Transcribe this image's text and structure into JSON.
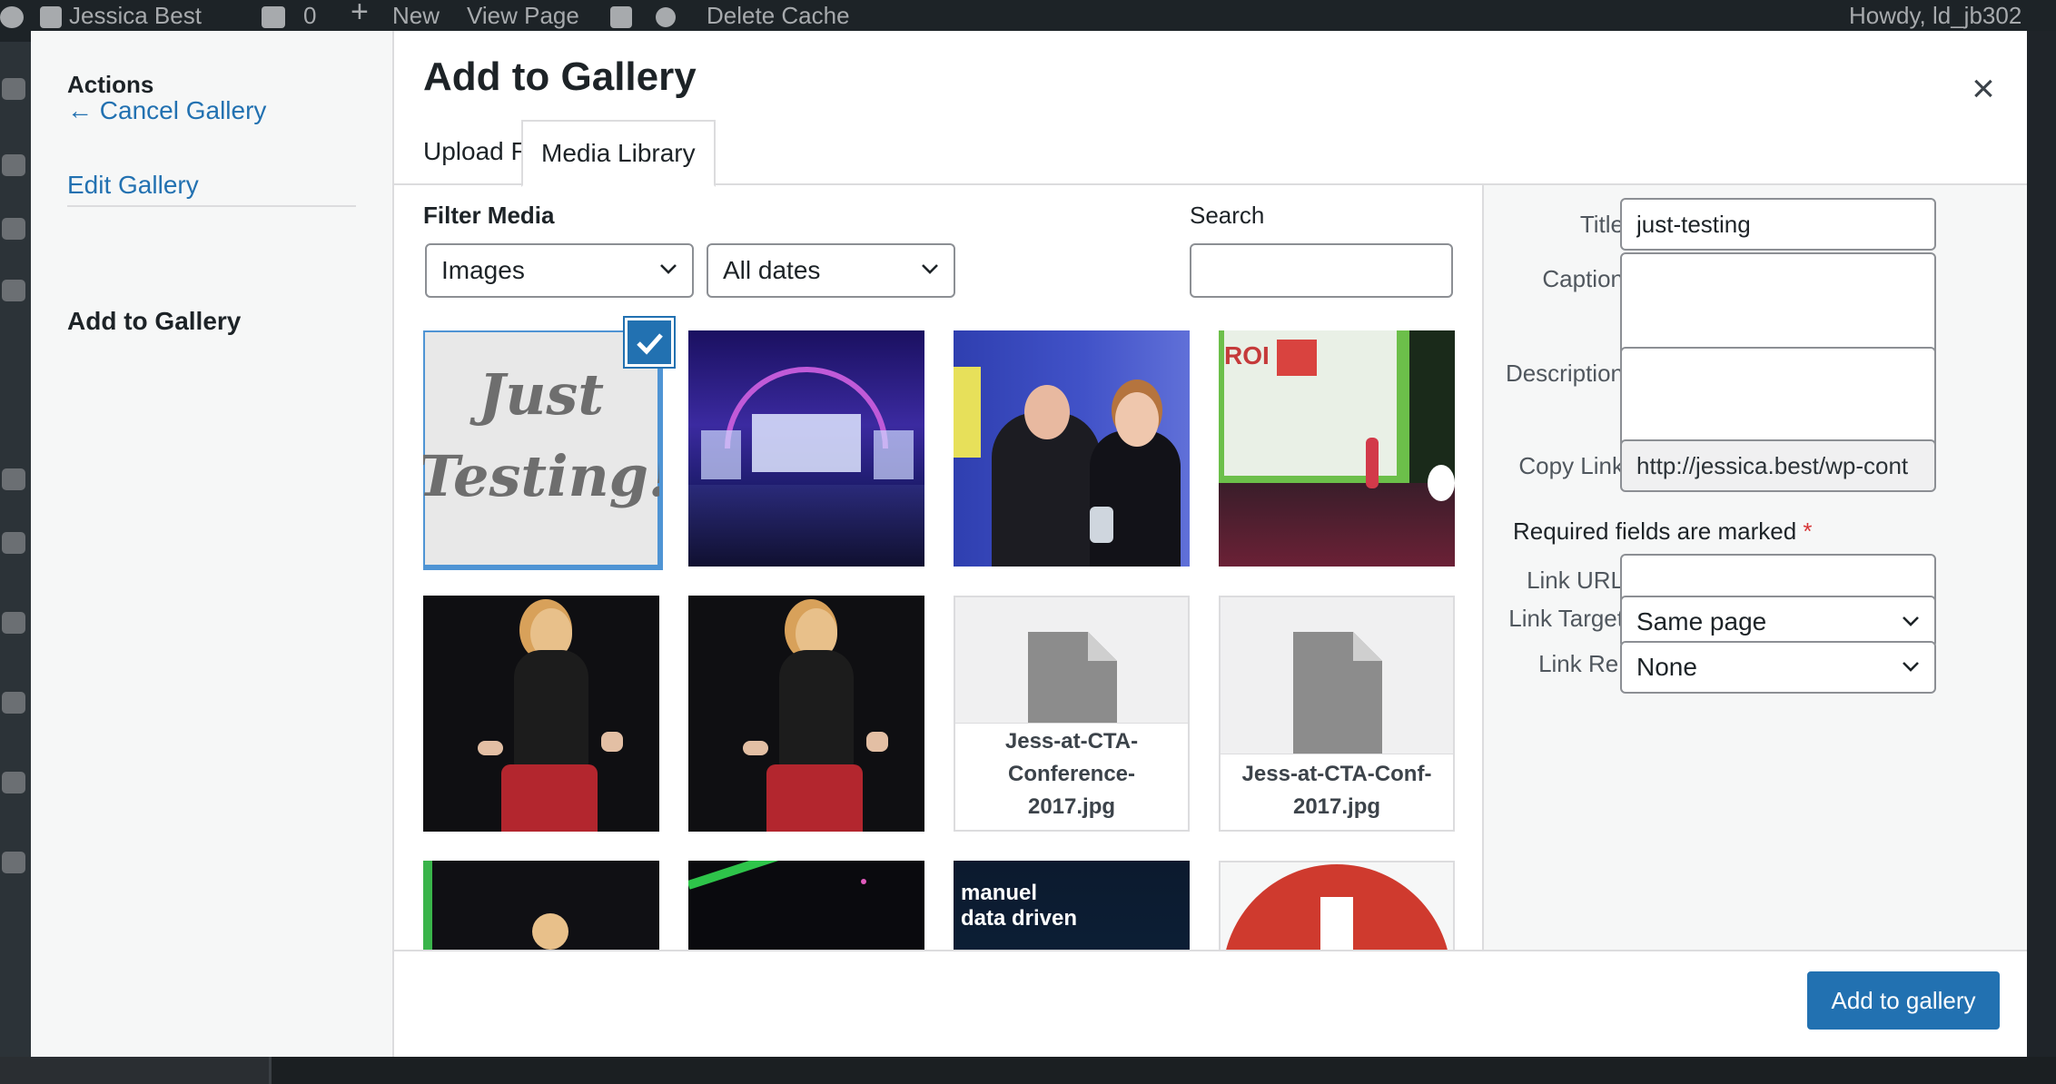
{
  "adminbar": {
    "site_name": "Jessica Best",
    "comments_count": "0",
    "new_label": "New",
    "view_page_label": "View Page",
    "delete_cache_label": "Delete Cache",
    "howdy": "Howdy, ld_jb302"
  },
  "menu": {
    "heading": "Actions",
    "cancel_gallery": "← Cancel Gallery",
    "edit_gallery": "Edit Gallery",
    "add_to_gallery": "Add to Gallery"
  },
  "frame": {
    "title": "Add to Gallery",
    "close_symbol": "×",
    "tabs": [
      {
        "label": "Upload Files"
      },
      {
        "label": "Media Library"
      }
    ]
  },
  "toolbar": {
    "filter_label": "Filter Media",
    "type_filter": "Images",
    "date_filter": "All dates",
    "search_label": "Search",
    "search_value": ""
  },
  "attachments": [
    {
      "kind": "image",
      "name": "just-testing",
      "lines": [
        "Just",
        "Testing!"
      ]
    },
    {
      "kind": "image",
      "name": "conference-stage"
    },
    {
      "kind": "image",
      "name": "award-photo"
    },
    {
      "kind": "image",
      "name": "keynote-stage",
      "sign_text": "ROI"
    },
    {
      "kind": "image",
      "name": "speaker-red-skirt-1"
    },
    {
      "kind": "image",
      "name": "speaker-red-skirt-2"
    },
    {
      "kind": "document",
      "filename_lines": [
        "Jess-at-CTA-",
        "Conference-",
        "2017.jpg"
      ]
    },
    {
      "kind": "document",
      "filename_lines": [
        "Jess-at-CTA-Conf-",
        "2017.jpg"
      ]
    },
    {
      "kind": "image",
      "name": "speaker-green-stage"
    },
    {
      "kind": "image",
      "name": "dark-stage"
    },
    {
      "kind": "image",
      "name": "data-slide",
      "lines": [
        "manuel",
        "data driven"
      ]
    },
    {
      "kind": "image",
      "name": "red-logo"
    }
  ],
  "details": {
    "title_label": "Title",
    "title_value": "just-testing",
    "caption_label": "Caption",
    "caption_value": "",
    "description_label": "Description",
    "description_value": "",
    "copy_link_label": "Copy Link",
    "copy_link_value": "http://jessica.best/wp-cont",
    "required_text": "Required fields are marked",
    "required_star": "*",
    "link_url_label": "Link URL",
    "link_url_value": "",
    "link_target_label": "Link Target",
    "link_target_value": "Same page",
    "link_rel_label": "Link Rel",
    "link_rel_value": "None"
  },
  "footer": {
    "add_button": "Add to gallery"
  },
  "colors": {
    "accent": "#2271b1",
    "selection_outline": "#4f94d4",
    "admin_bar": "#1d2327",
    "required_star": "#d63638"
  }
}
